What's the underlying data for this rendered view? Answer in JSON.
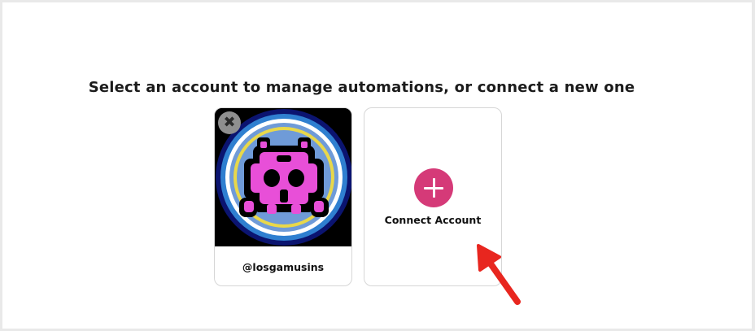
{
  "heading": "Select an account to manage automations, or connect a new one",
  "accounts": [
    {
      "handle": "@losgamusins",
      "remove_icon": "close-icon",
      "avatar": "space-invader-avatar"
    }
  ],
  "connect": {
    "label": "Connect Account",
    "icon": "plus-icon"
  },
  "colors": {
    "accent": "#d53a78",
    "arrow": "#e8261f",
    "avatar_pink": "#e84fd8",
    "avatar_blue": "#6f9bd8"
  }
}
